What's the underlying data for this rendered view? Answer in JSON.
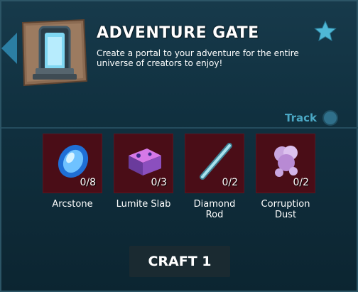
{
  "item": {
    "title": "ADVENTURE GATE",
    "description": "Create a portal to your adventure for the entire universe of creators to enjoy!"
  },
  "track": {
    "label": "Track"
  },
  "ingredients": [
    {
      "name": "Arcstone",
      "count": "0/8",
      "icon": "arcstone-icon"
    },
    {
      "name": "Lumite Slab",
      "count": "0/3",
      "icon": "lumite-slab-icon"
    },
    {
      "name": "Diamond Rod",
      "count": "0/2",
      "icon": "diamond-rod-icon"
    },
    {
      "name": "Corruption Dust",
      "count": "0/2",
      "icon": "corruption-dust-icon"
    }
  ],
  "craft": {
    "label": "CRAFT 1"
  },
  "colors": {
    "panel": "#10303f",
    "ingredient_bg": "#4a0d17",
    "accent": "#4aa7c4",
    "star": "#4fb8d6"
  }
}
